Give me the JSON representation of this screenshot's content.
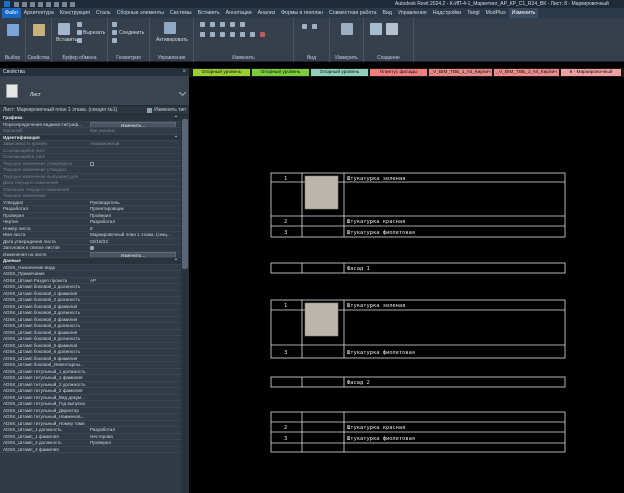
{
  "window": {
    "title": "Autodesk Revit 2024.2 - К-ИП-4-1_Маркетинг_АР_КР_С1_R24_ВК - Лист: 8 - Маркировочный"
  },
  "ribbon_tabs": [
    {
      "label": "Файл",
      "kind": "file"
    },
    {
      "label": "Архитектура"
    },
    {
      "label": "Конструкция"
    },
    {
      "label": "Сталь"
    },
    {
      "label": "Сборные элементы"
    },
    {
      "label": "Системы"
    },
    {
      "label": "Вставить"
    },
    {
      "label": "Аннотации"
    },
    {
      "label": "Анализ"
    },
    {
      "label": "Формы и генплан"
    },
    {
      "label": "Совместная работа"
    },
    {
      "label": "Вид"
    },
    {
      "label": "Управление"
    },
    {
      "label": "Надстройки"
    },
    {
      "label": "Tangl"
    },
    {
      "label": "ModPlus"
    },
    {
      "label": "Изменить",
      "kind": "active"
    }
  ],
  "ribbon": {
    "select_label": "Выбор",
    "properties_label": "Свойства",
    "clipboard_label": "Буфер обмена",
    "paste_label": "Вставить",
    "cut_label": "Вырезать",
    "join_label": "Соединить",
    "geometry_label": "Геометрия",
    "activate_label": "Активировать",
    "control_label": "Управление",
    "modify_label": "Изменить",
    "view_label": "Вид",
    "measure_label": "Измерить",
    "create_label": "Создание"
  },
  "properties": {
    "title": "Свойства",
    "type_name": "Лист",
    "instance_label": "Лист: Маркировочный план 1 этажа. (секция №1)",
    "edit_type_label": "Изменить тип",
    "rows": [
      {
        "kind": "section",
        "label": "Графика"
      },
      {
        "label": "Переопределения видимости/граф...",
        "button": "Изменить..."
      },
      {
        "label": "Масштаб",
        "value": "Как указано",
        "disabled": true
      },
      {
        "kind": "section",
        "label": "Идентификация"
      },
      {
        "label": "Зависимость уровня",
        "value": "Независимый",
        "disabled": true
      },
      {
        "label": "Ссылающийся лист",
        "disabled": true
      },
      {
        "label": "Ссылающийся узел",
        "disabled": true
      },
      {
        "label": "Текущее изменение утверждено",
        "checkbox": false,
        "disabled": true
      },
      {
        "label": "Текущее изменение утвердил",
        "disabled": true
      },
      {
        "label": "Текущее изменение выпущено для",
        "disabled": true
      },
      {
        "label": "Дата текущего изменения",
        "disabled": true
      },
      {
        "label": "Описание текущего изменения",
        "disabled": true
      },
      {
        "label": "Текущее изменение",
        "disabled": true
      },
      {
        "label": "Утвердил",
        "value": "Руководитель"
      },
      {
        "label": "Разработал",
        "value": "Проектировщик"
      },
      {
        "label": "Проверил",
        "value": "Проверил"
      },
      {
        "label": "Чертил",
        "value": "Разработал"
      },
      {
        "label": "Номер листа",
        "value": "8"
      },
      {
        "label": "Имя листа",
        "value": "Маркировочный план 1 этажа. (секц..."
      },
      {
        "label": "Дата утверждения листа",
        "value": "02/16/22"
      },
      {
        "label": "Заголовок в списке листов",
        "checkbox": true
      },
      {
        "label": "Изменения на листе",
        "button": "Изменить..."
      },
      {
        "kind": "section",
        "label": "Данные"
      },
      {
        "label": "ADSK_Назначение вида"
      },
      {
        "label": "ADSK_Примечание"
      },
      {
        "label": "ADSK_Штамп Раздел проекта",
        "value": "АР"
      },
      {
        "label": "ADSK_Штамп боковой_1 должность"
      },
      {
        "label": "ADSK_Штамп боковой_1 фамилия"
      },
      {
        "label": "ADSK_Штамп боковой_2 должность"
      },
      {
        "label": "ADSK_Штамп боковой_2 фамилия"
      },
      {
        "label": "ADSK_Штамп боковой_3 должность"
      },
      {
        "label": "ADSK_Штамп боковой_3 фамилия"
      },
      {
        "label": "ADSK_Штамп боковой_4 должность"
      },
      {
        "label": "ADSK_Штамп боковой_4 фамилия"
      },
      {
        "label": "ADSK_Штамп боковой_5 должность"
      },
      {
        "label": "ADSK_Штамп боковой_5 фамилия"
      },
      {
        "label": "ADSK_Штамп боковой_6 должность"
      },
      {
        "label": "ADSK_Штамп боковой_6 фамилия"
      },
      {
        "label": "ADSK_Штамп боковой_Инвентарны..."
      },
      {
        "label": "ADSK_Штамп титульный_1 должность"
      },
      {
        "label": "ADSK_Штамп титульный_1 фамилия"
      },
      {
        "label": "ADSK_Штамп титульный_2 должность"
      },
      {
        "label": "ADSK_Штамп титульный_2 фамилия"
      },
      {
        "label": "ADSK_Штамп титульный_Вид докум..."
      },
      {
        "label": "ADSK_Штамп титульный_Год выпуска"
      },
      {
        "label": "ADSK_Штамп титульный_Директор"
      },
      {
        "label": "ADSK_Штамп титульный_Наименов..."
      },
      {
        "label": "ADSK_Штамп титульный_Номер тома"
      },
      {
        "label": "ADSK_Штамп_1 должность",
        "value": "Разработал"
      },
      {
        "label": "ADSK_Штамп_1 фамилия",
        "value": "Нестерова"
      },
      {
        "label": "ADSK_Штамп_2 должность",
        "value": "Проверил"
      },
      {
        "label": "ADSK_Штамп_2 фамилия"
      }
    ]
  },
  "view_tabs": [
    {
      "label": "Опорный уровень",
      "color": "#9acd32"
    },
    {
      "label": "Опорный уровень",
      "color": "#7ccd3a"
    },
    {
      "label": "Опорный уровень",
      "color": "#8fd0b8"
    },
    {
      "label": "Плинтус фасады",
      "color": "#f08080"
    },
    {
      "label": "_V_BIM_ТВБ_1_Nt_Кирпич",
      "color": "#e98a8a"
    },
    {
      "label": "_V_BIM_ТВБ_2_Nt_Кирпич",
      "color": "#ee8d8d"
    },
    {
      "label": "8 - Маркировочный",
      "color": "#f0a0a0"
    }
  ],
  "schedule": {
    "block1": [
      {
        "num": "1",
        "swatch": true,
        "text": "Штукатурка зеленая"
      },
      {
        "num": "2",
        "text": "Штукатурка красная"
      },
      {
        "num": "3",
        "text": "Штукатурка фиолетовая"
      }
    ],
    "facade1": "Фасад 1",
    "block2": [
      {
        "num": "1",
        "swatch": true,
        "text": "Штукатурка зеленая"
      },
      {
        "num": "3",
        "text": "Штукатурка фиолетовая"
      }
    ],
    "facade2": "Фасад 2",
    "block3": [
      {
        "num": "2",
        "text": "Штукатурка красная"
      },
      {
        "num": "3",
        "text": "Штукатурка фиолетовая"
      }
    ]
  },
  "colors": {
    "accent": "#1769c7",
    "swatch": "#bdb6ad"
  }
}
